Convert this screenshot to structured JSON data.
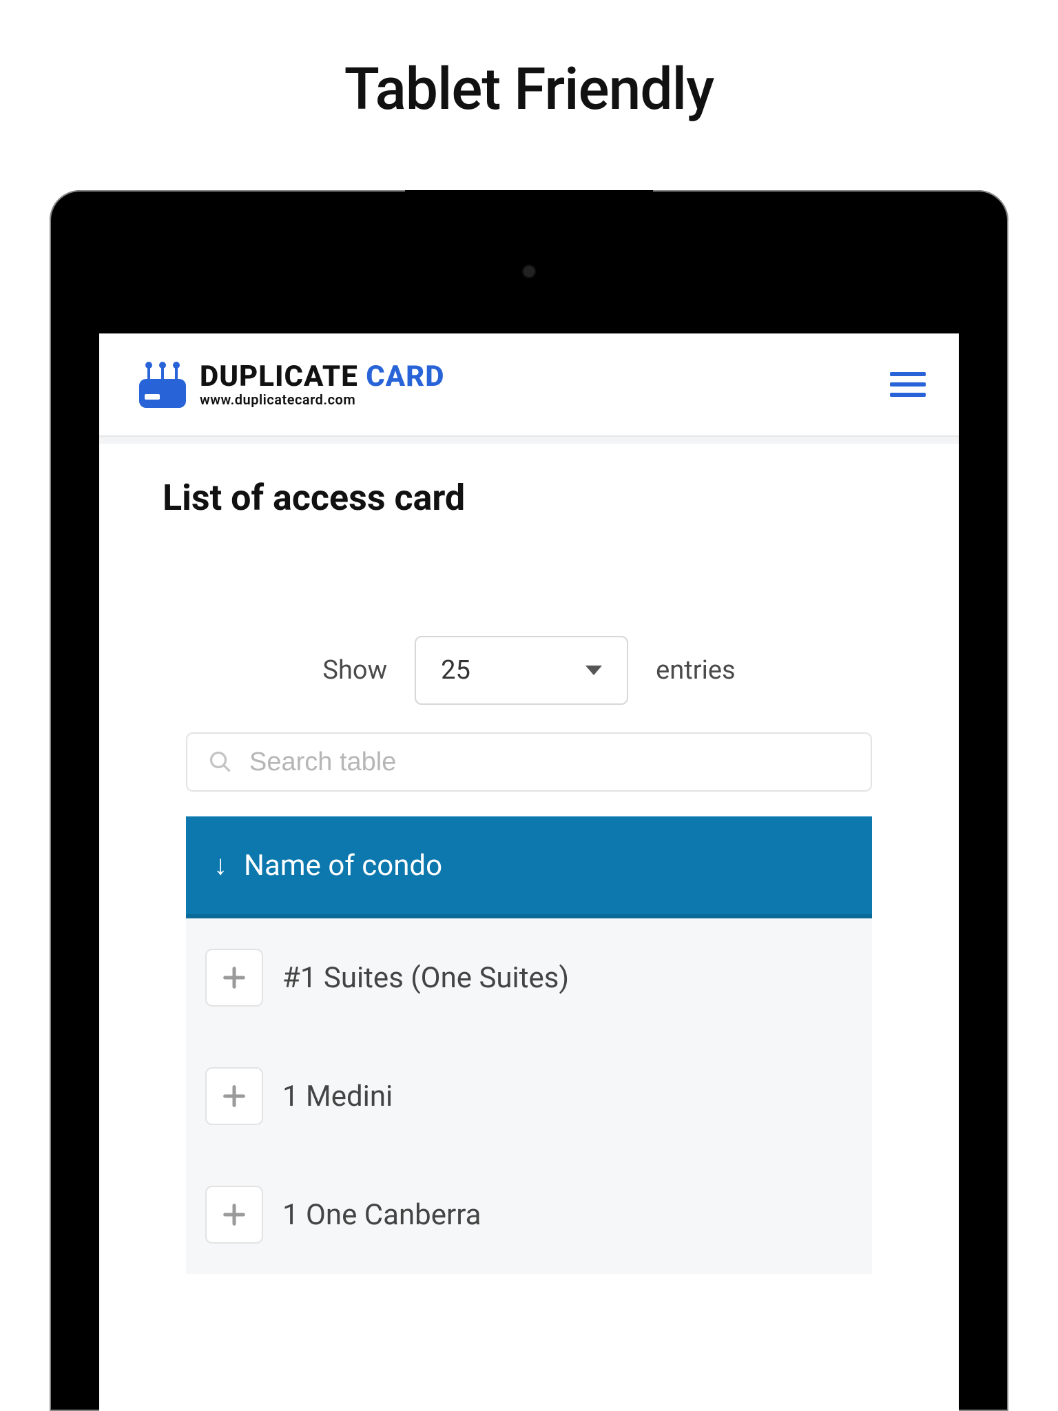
{
  "page": {
    "title": "Tablet Friendly"
  },
  "header": {
    "logo": {
      "name_part1": "DUPLICATE",
      "name_part2": "CARD",
      "subtitle": "www.duplicatecard.com"
    }
  },
  "content": {
    "title": "List of access card",
    "show_label": "Show",
    "entries_label": "entries",
    "page_size": "25",
    "search_placeholder": "Search table",
    "table": {
      "column_header": "Name of condo",
      "rows": [
        {
          "label": "#1 Suites (One Suites)"
        },
        {
          "label": "1 Medini"
        },
        {
          "label": "1 One Canberra"
        }
      ]
    }
  }
}
